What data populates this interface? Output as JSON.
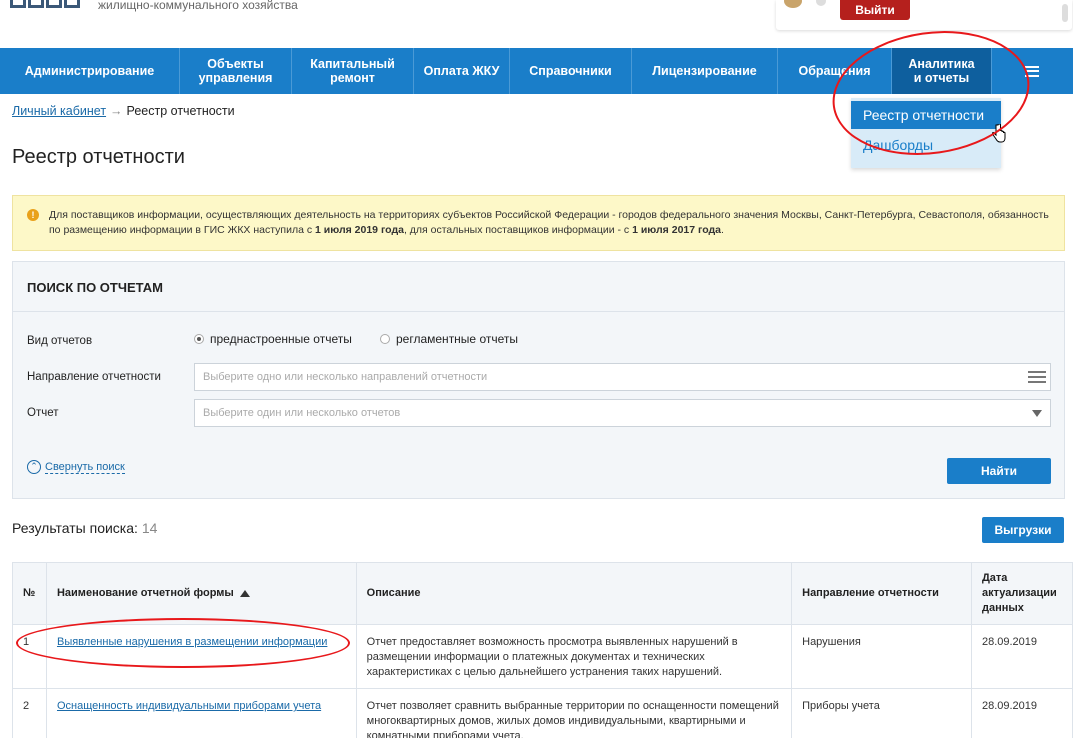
{
  "header": {
    "site_subtitle": "жилищно-коммунального хозяйства",
    "logout_label": "Выйти"
  },
  "nav": {
    "items": [
      {
        "label": "Администрирование"
      },
      {
        "label": "Объекты управления"
      },
      {
        "label": "Капитальный ремонт"
      },
      {
        "label": "Оплата ЖКУ"
      },
      {
        "label": "Справочники"
      },
      {
        "label": "Лицензирование"
      },
      {
        "label": "Обращения"
      },
      {
        "label": "Аналитика и отчеты"
      }
    ],
    "menu_icon": "hamburger-icon"
  },
  "dropdown": {
    "items": [
      {
        "label": "Реестр отчетности"
      },
      {
        "label": "Дашборды"
      }
    ]
  },
  "breadcrumb": {
    "home": "Личный кабинет",
    "separator": "→",
    "current": "Реестр отчетности"
  },
  "page_title": "Реестр отчетности",
  "notice": {
    "text_1": "Для поставщиков информации, осуществляющих деятельность на территориях субъектов Российской Федерации - городов федерального значения Москвы, Санкт-Петербурга, Севастополя, обязанность по размещению информации в ГИС ЖКХ наступила с ",
    "date_1": "1 июля 2019 года",
    "text_2": ", для остальных поставщиков информации - с ",
    "date_2": "1 июля 2017 года",
    "text_3": "."
  },
  "search": {
    "title": "ПОИСК ПО ОТЧЕТАМ",
    "report_type_label": "Вид отчетов",
    "radio_1": "преднастроенные отчеты",
    "radio_2": "регламентные отчеты",
    "direction_label": "Направление отчетности",
    "direction_placeholder": "Выберите одно или несколько направлений отчетности",
    "report_label": "Отчет",
    "report_placeholder": "Выберите один или несколько отчетов",
    "collapse_label": "Свернуть поиск",
    "find_label": "Найти"
  },
  "results": {
    "label": "Результаты поиска:",
    "count": "14",
    "export_label": "Выгрузки"
  },
  "table": {
    "headers": {
      "num": "№",
      "name": "Наименование отчетной формы",
      "desc": "Описание",
      "dir": "Направление отчетности",
      "date": "Дата актуализации данных"
    },
    "rows": [
      {
        "num": "1",
        "name": "Выявленные нарушения в размещении информации",
        "desc": "Отчет предоставляет возможность просмотра выявленных нарушений в размещении информации о платежных документах и технических характеристиках с целью дальнейшего устранения таких нарушений.",
        "dir": "Нарушения",
        "date": "28.09.2019"
      },
      {
        "num": "2",
        "name": "Оснащенность индивидуальными приборами учета",
        "desc": "Отчет позволяет сравнить выбранные территории по оснащенности помещений многоквартирных домов, жилых домов индивидуальными, квартирными и комнатными приборами учета.",
        "dir": "Приборы учета",
        "date": "28.09.2019"
      }
    ]
  }
}
